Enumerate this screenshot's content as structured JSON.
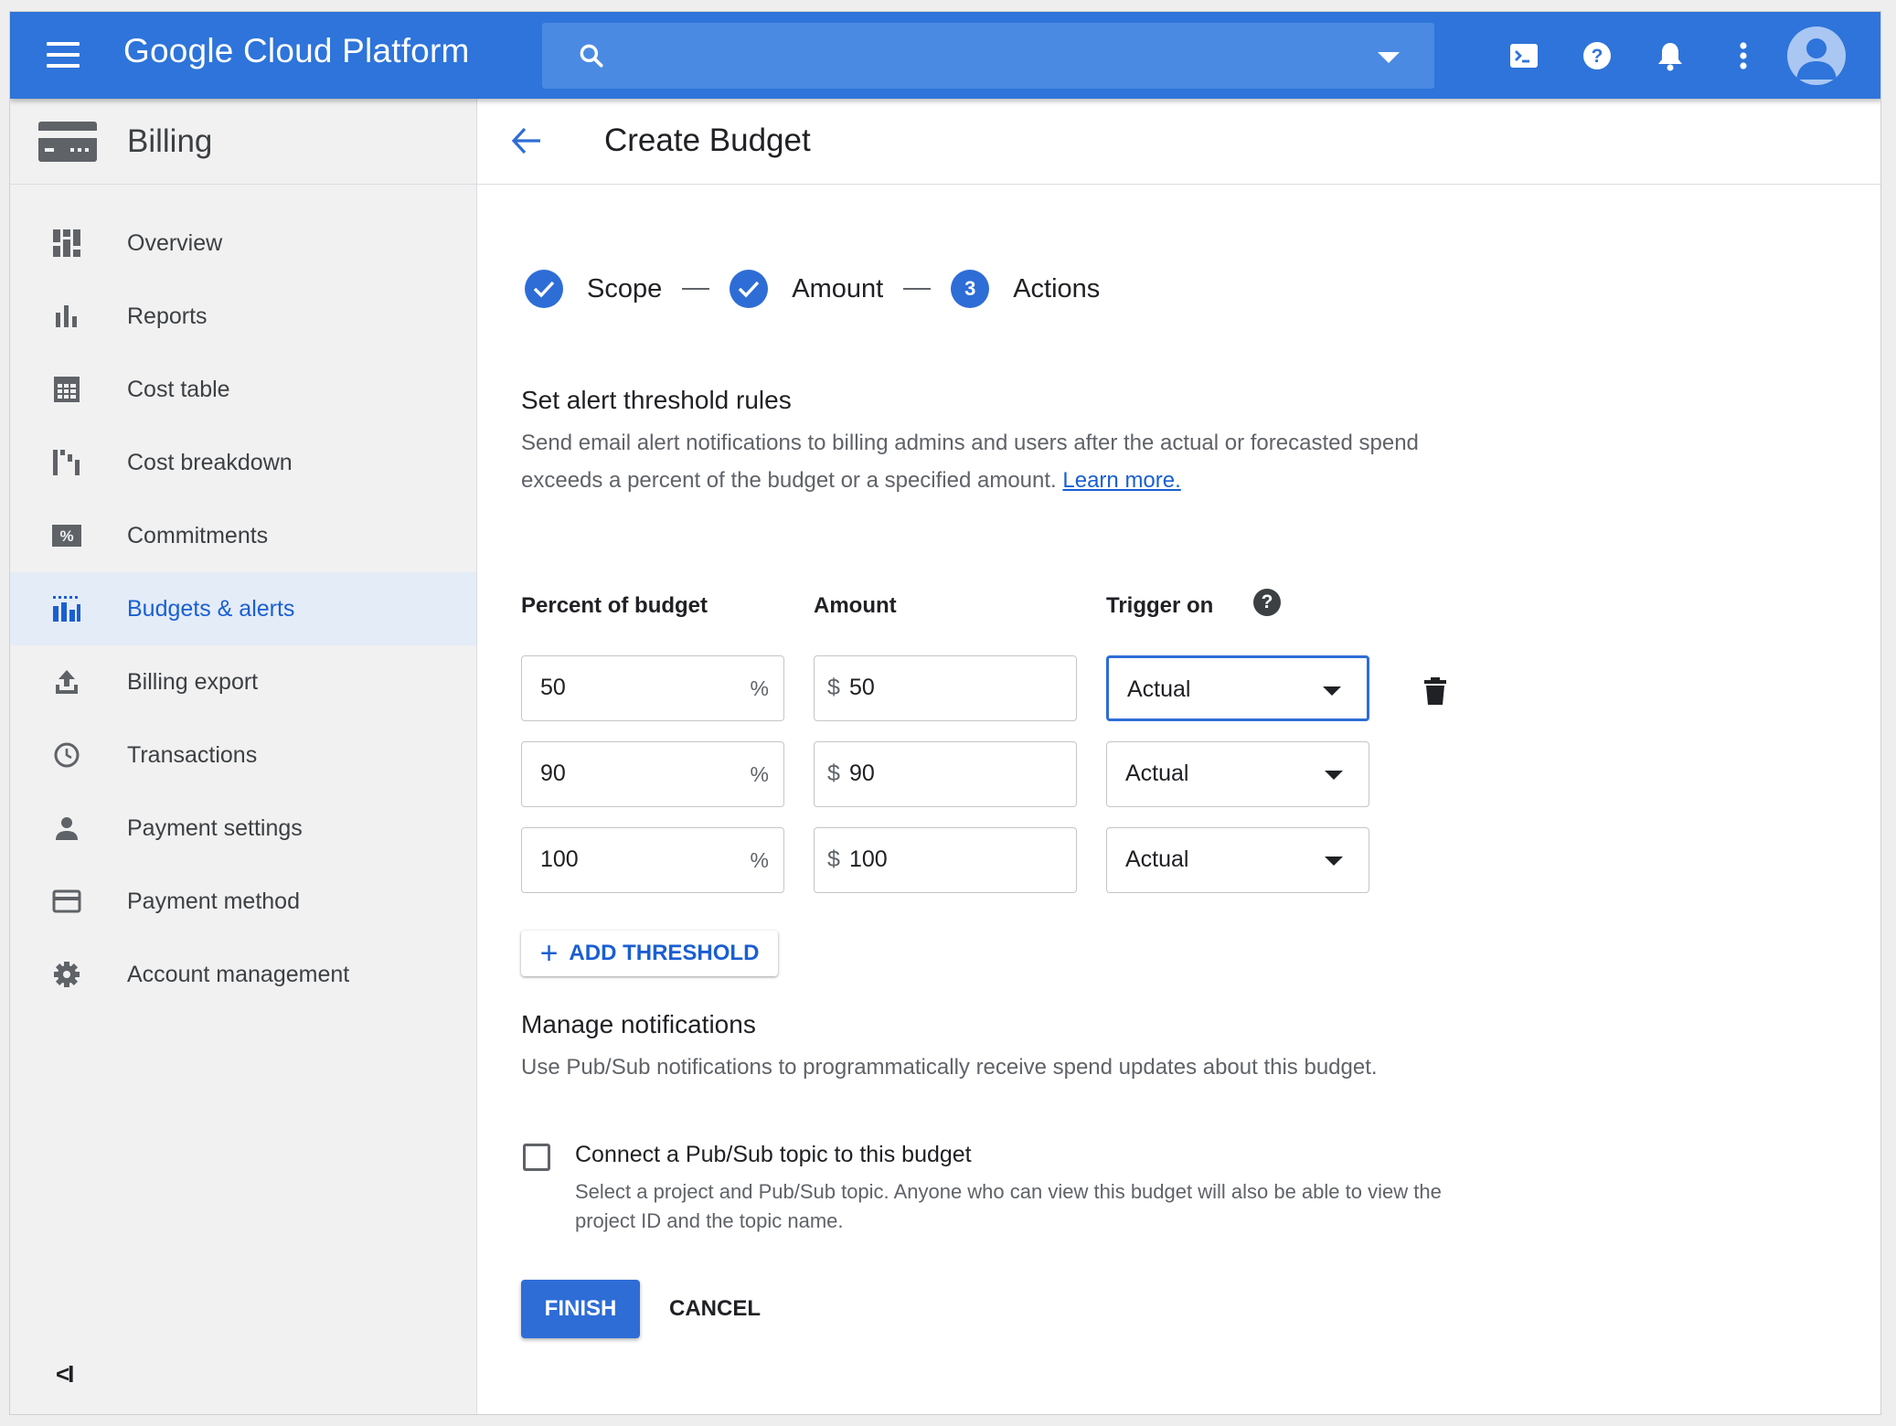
{
  "topbar": {
    "brand": "Google Cloud Platform",
    "icons": [
      "menu-icon",
      "search-icon",
      "chevron-down-icon",
      "cloud-shell-icon",
      "help-icon",
      "notifications-icon",
      "more-vert-icon",
      "account-icon"
    ],
    "color": "#2e74da"
  },
  "sidebar": {
    "title": "Billing",
    "items": [
      {
        "label": "Overview",
        "icon": "dashboard-icon"
      },
      {
        "label": "Reports",
        "icon": "bar-chart-icon"
      },
      {
        "label": "Cost table",
        "icon": "table-icon"
      },
      {
        "label": "Cost breakdown",
        "icon": "waterfall-icon"
      },
      {
        "label": "Commitments",
        "icon": "percent-icon"
      },
      {
        "label": "Budgets & alerts",
        "icon": "budget-icon",
        "active": true
      },
      {
        "label": "Billing export",
        "icon": "upload-icon"
      },
      {
        "label": "Transactions",
        "icon": "clock-icon"
      },
      {
        "label": "Payment settings",
        "icon": "person-icon"
      },
      {
        "label": "Payment method",
        "icon": "credit-card-icon"
      },
      {
        "label": "Account management",
        "icon": "gear-icon"
      }
    ],
    "collapse_label": "<I"
  },
  "main": {
    "title": "Create Budget",
    "steps": [
      {
        "label": "Scope",
        "state": "done"
      },
      {
        "label": "Amount",
        "state": "done"
      },
      {
        "label": "Actions",
        "state": "current",
        "number": "3"
      }
    ],
    "threshold": {
      "title": "Set alert threshold rules",
      "description": "Send email alert notifications to billing admins and users after the actual or forecasted spend exceeds a percent of the budget or a specified amount.",
      "learn_more": "Learn more.",
      "columns": {
        "percent": "Percent of budget",
        "amount": "Amount",
        "trigger": "Trigger on"
      },
      "rows": [
        {
          "percent": "50",
          "percent_suffix": "%",
          "currency": "$",
          "amount": "50",
          "trigger": "Actual"
        },
        {
          "percent": "90",
          "percent_suffix": "%",
          "currency": "$",
          "amount": "90",
          "trigger": "Actual"
        },
        {
          "percent": "100",
          "percent_suffix": "%",
          "currency": "$",
          "amount": "100",
          "trigger": "Actual"
        }
      ],
      "add_label": "ADD THRESHOLD",
      "add_symbol": "+"
    },
    "notifications": {
      "title": "Manage notifications",
      "description": "Use Pub/Sub notifications to programmatically receive spend updates about this budget.",
      "checkbox_label": "Connect a Pub/Sub topic to this budget",
      "checkbox_checked": false,
      "checkbox_help": "Select a project and Pub/Sub topic. Anyone who can view this budget will also be able to view the project ID and the topic name."
    },
    "finish_label": "FINISH",
    "cancel_label": "CANCEL",
    "accent": "#2e6dd6"
  }
}
